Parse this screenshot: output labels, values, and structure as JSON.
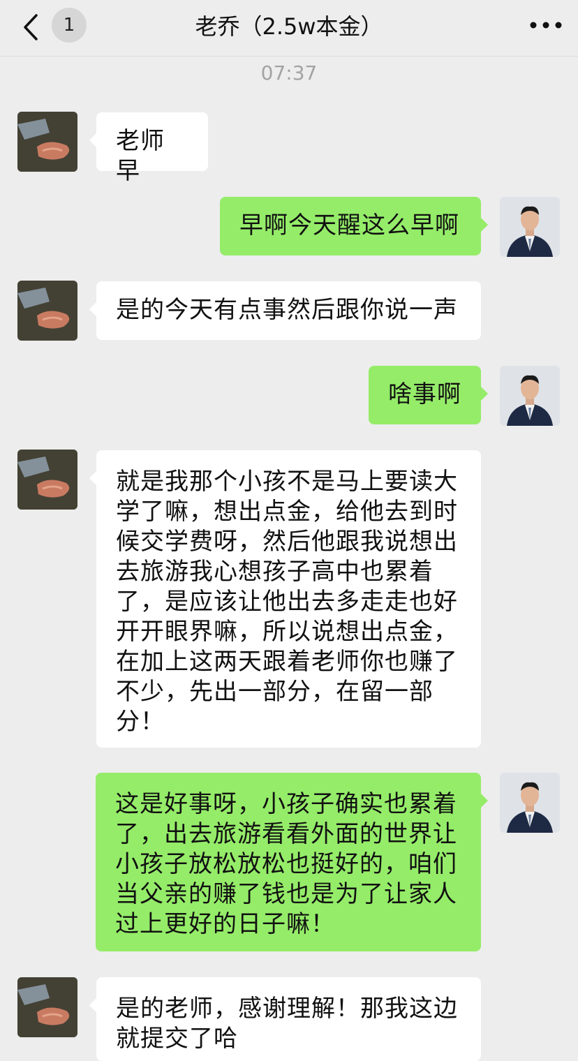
{
  "header": {
    "back_icon": "chevron-left-icon",
    "unread_count": "1",
    "title": "老乔（2.5w本金）",
    "more_icon": "more-dots-icon"
  },
  "timestamp": "07:37",
  "colors": {
    "background": "#ededed",
    "incoming_bubble": "#ffffff",
    "outgoing_bubble": "#95ec69"
  },
  "messages": [
    {
      "sender": "contact",
      "text": "老师早"
    },
    {
      "sender": "me",
      "text": "早啊今天醒这么早啊"
    },
    {
      "sender": "contact",
      "text": "是的今天有点事然后跟你说一声"
    },
    {
      "sender": "me",
      "text": "啥事啊"
    },
    {
      "sender": "contact",
      "text": "就是我那个小孩不是马上要读大学了嘛，想出点金，给他去到时候交学费呀，然后他跟我说想出去旅游我心想孩子高中也累着了，是应该让他出去多走走也好开开眼界嘛，所以说想出点金，在加上这两天跟着老师你也赚了不少，先出一部分，在留一部分！"
    },
    {
      "sender": "me",
      "text": "这是好事呀，小孩子确实也累着了，出去旅游看看外面的世界让小孩子放松放松也挺好的，咱们当父亲的赚了钱也是为了让家人过上更好的日子嘛！"
    },
    {
      "sender": "contact",
      "text": "是的老师，感谢理解！那我这边就提交了哈"
    }
  ]
}
